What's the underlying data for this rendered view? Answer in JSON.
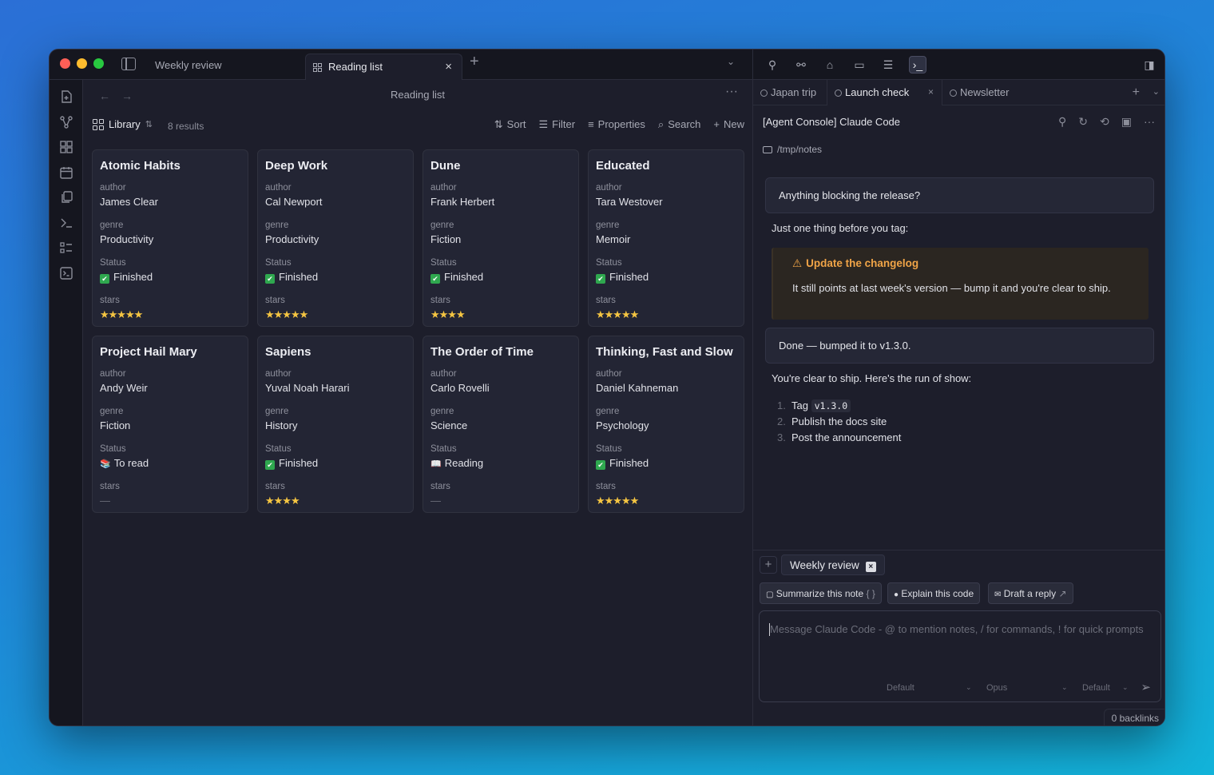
{
  "title_tabs": {
    "inactive": "Weekly review",
    "active": "Reading list"
  },
  "page": {
    "title": "Reading list",
    "library_label": "Library",
    "results": "8 results",
    "tools": {
      "sort": "Sort",
      "filter": "Filter",
      "properties": "Properties",
      "search": "Search",
      "new": "New"
    }
  },
  "cards": [
    {
      "title": "Atomic Habits",
      "author": "James Clear",
      "genre": "Productivity",
      "status": "Finished",
      "status_icon": "check",
      "stars": "★★★★★"
    },
    {
      "title": "Deep Work",
      "author": "Cal Newport",
      "genre": "Productivity",
      "status": "Finished",
      "status_icon": "check",
      "stars": "★★★★★"
    },
    {
      "title": "Dune",
      "author": "Frank Herbert",
      "genre": "Fiction",
      "status": "Finished",
      "status_icon": "check",
      "stars": "★★★★"
    },
    {
      "title": "Educated",
      "author": "Tara Westover",
      "genre": "Memoir",
      "status": "Finished",
      "status_icon": "check",
      "stars": "★★★★★"
    },
    {
      "title": "Project Hail Mary",
      "author": "Andy Weir",
      "genre": "Fiction",
      "status": "To read",
      "status_icon": "books",
      "stars": "—"
    },
    {
      "title": "Sapiens",
      "author": "Yuval Noah Harari",
      "genre": "History",
      "status": "Finished",
      "status_icon": "check",
      "stars": "★★★★"
    },
    {
      "title": "The Order of Time",
      "author": "Carlo Rovelli",
      "genre": "Science",
      "status": "Reading",
      "status_icon": "book",
      "stars": "—"
    },
    {
      "title": "Thinking, Fast and Slow",
      "author": "Daniel Kahneman",
      "genre": "Psychology",
      "status": "Finished",
      "status_icon": "check",
      "stars": "★★★★★"
    }
  ],
  "labels": {
    "author": "author",
    "genre": "genre",
    "status": "Status",
    "stars": "stars"
  },
  "right_tabs": [
    {
      "label": "Japan trip"
    },
    {
      "label": "Launch check"
    },
    {
      "label": "Newsletter"
    }
  ],
  "console": {
    "title": "[Agent Console] Claude Code",
    "path": "/tmp/notes",
    "user_msg_1": "Anything blocking the release?",
    "reply_1": "Just one thing before you tag:",
    "callout_title": "Update the changelog",
    "callout_body": "It still points at last week's version — bump it and you're clear to ship.",
    "user_msg_2": "Done — bumped it to v1.3.0.",
    "reply_2": "You're clear to ship. Here's the run of show:",
    "steps": [
      {
        "num": "1.",
        "text": "Tag",
        "code": "v1.3.0"
      },
      {
        "num": "2.",
        "text": "Publish the docs site"
      },
      {
        "num": "3.",
        "text": "Post the announcement"
      }
    ]
  },
  "composer": {
    "context_chip": "Weekly review",
    "prompts": [
      "Summarize this note",
      "Explain this code",
      "Draft a reply"
    ],
    "placeholder": "Message Claude Code - @ to mention notes, / for commands, ! for quick prompts",
    "selects": [
      "Default",
      "Opus",
      "Default"
    ]
  },
  "backlinks": "0 backlinks",
  "colors": {
    "accent_warning": "#f0a447",
    "star": "#f5c542",
    "check": "#2fa84f"
  }
}
